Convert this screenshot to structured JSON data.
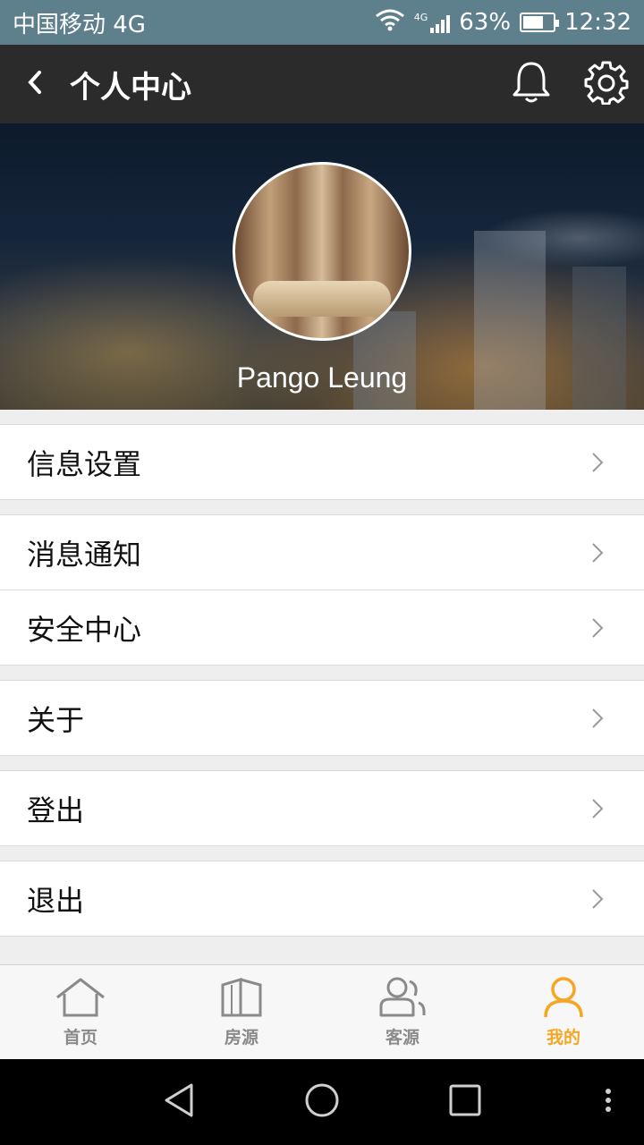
{
  "status_bar": {
    "carrier": "中国移动 4G",
    "network_badge": "4G",
    "battery": "63%",
    "time": "12:32"
  },
  "header": {
    "title": "个人中心",
    "icons": [
      "back-icon",
      "bell-icon",
      "gear-icon"
    ]
  },
  "profile": {
    "name": "Pango Leung"
  },
  "menu": {
    "items": [
      {
        "label": "信息设置"
      },
      {
        "label": "消息通知"
      },
      {
        "label": "安全中心"
      },
      {
        "label": "关于"
      },
      {
        "label": "登出"
      },
      {
        "label": "退出"
      }
    ]
  },
  "tabs": [
    {
      "label": "首页",
      "icon": "home-icon"
    },
    {
      "label": "房源",
      "icon": "building-icon"
    },
    {
      "label": "客源",
      "icon": "customers-icon"
    },
    {
      "label": "我的",
      "icon": "user-icon"
    }
  ],
  "colors": {
    "status_bar": "#5e7f8c",
    "app_bar": "#2b2b2b",
    "accent": "#f5a623",
    "inactive_tab": "#8a8a8a"
  }
}
